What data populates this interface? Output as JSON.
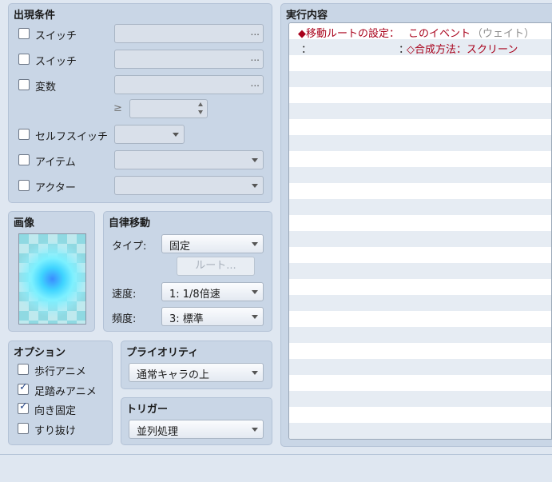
{
  "conditions": {
    "title": "出現条件",
    "switch1_label": "スイッチ",
    "switch2_label": "スイッチ",
    "variable_label": "変数",
    "ge_symbol": "≥",
    "self_switch_label": "セルフスイッチ",
    "item_label": "アイテム",
    "actor_label": "アクター",
    "ellipsis": "..."
  },
  "image": {
    "title": "画像"
  },
  "autonomous_movement": {
    "title": "自律移動",
    "type_label": "タイプ:",
    "type_value": "固定",
    "route_button": "ルート...",
    "speed_label": "速度:",
    "speed_value": "1: 1/8倍速",
    "freq_label": "頻度:",
    "freq_value": "3: 標準"
  },
  "options": {
    "title": "オプション",
    "walking": {
      "label": "歩行アニメ",
      "checked": false
    },
    "stepping": {
      "label": "足踏みアニメ",
      "checked": true
    },
    "direction_fix": {
      "label": "向き固定",
      "checked": true
    },
    "through": {
      "label": "すり抜け",
      "checked": false
    }
  },
  "priority": {
    "title": "プライオリティ",
    "value": "通常キャラの上"
  },
  "trigger": {
    "title": "トリガー",
    "value": "並列処理"
  },
  "contents": {
    "title": "実行内容",
    "line1_prefix": "◆移動ルートの設定：",
    "line1_target": "このイベント",
    "line1_wait": "（ウェイト）",
    "line2_colon": "：",
    "line2_colon2": "：",
    "line2_command": "◇合成方法：スクリーン"
  },
  "colors": {
    "panel": "#c9d6e6",
    "background": "#dfe7f1",
    "command_red": "#a8001a"
  }
}
